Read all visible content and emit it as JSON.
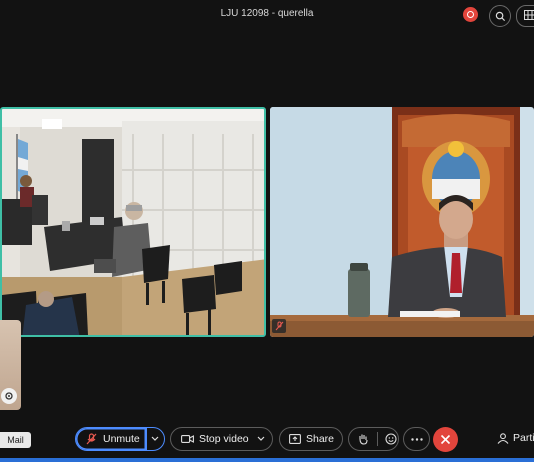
{
  "window": {
    "title": "LJU 12098 - querella"
  },
  "colors": {
    "accent": "#3fbfa6",
    "end_call": "#e2453c",
    "focus": "#4d8cff",
    "background": "#121212"
  },
  "toolbar": {
    "unmute_label": "Unmute",
    "stop_video_label": "Stop video",
    "share_label": "Share",
    "participants_label": "Parti"
  },
  "tooltip": {
    "label": "Mail"
  },
  "icons": [
    "record-icon",
    "search-icon",
    "layout-icon",
    "mic-muted-icon",
    "chevron-down-icon",
    "video-icon",
    "share-icon",
    "raise-hand-icon",
    "emoji-icon",
    "more-icon",
    "end-call-icon",
    "participants-icon",
    "gear-icon"
  ]
}
